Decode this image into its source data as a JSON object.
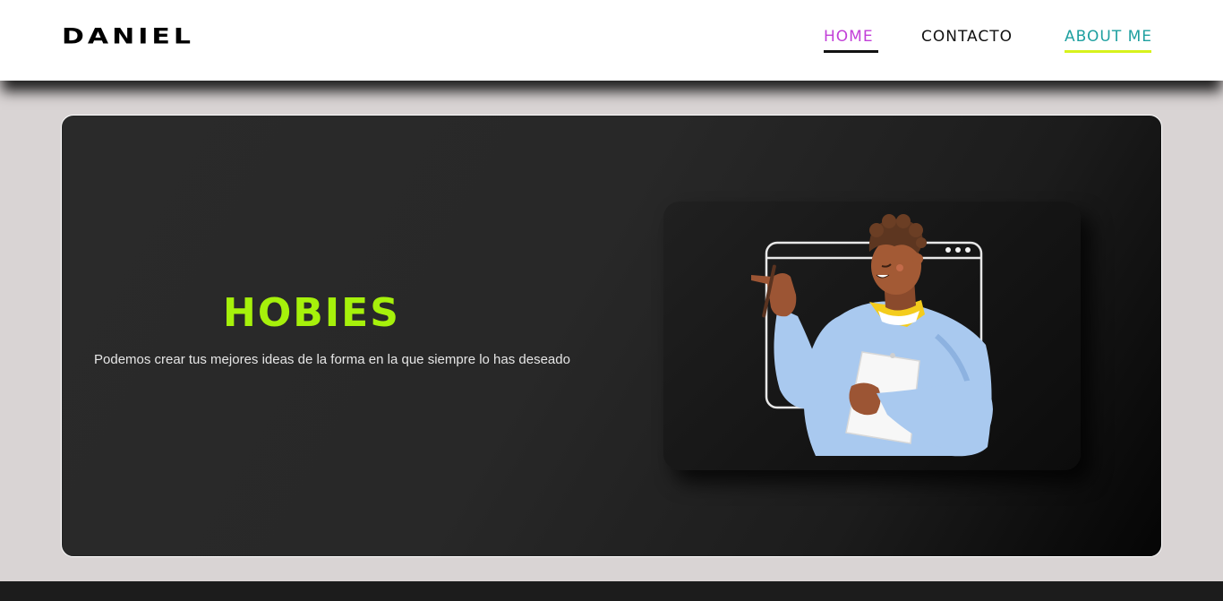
{
  "header": {
    "logo": "DANIEL",
    "nav": [
      {
        "label": "HOME",
        "color": "#c23fd8",
        "underline": "#111111"
      },
      {
        "label": "CONTACTO",
        "color": "#111111"
      },
      {
        "label": "ABOUT ME",
        "color": "#1fa0a0",
        "underline": "#d7f21c"
      }
    ]
  },
  "hero": {
    "title": "HOBIES",
    "title_color": "#a6f10b",
    "text": "Podemos crear tus mejores ideas de la forma en la que siempre lo has deseado"
  },
  "illustration": {
    "icon": "person-pointing-with-clipboard-illustration"
  }
}
